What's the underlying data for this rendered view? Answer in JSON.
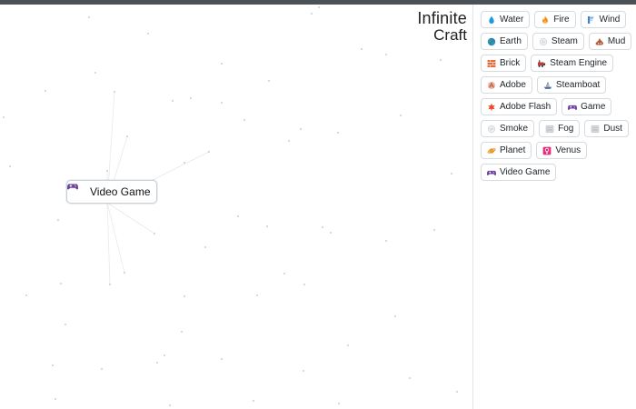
{
  "logo": {
    "line1": "Infinite",
    "line2": "Craft"
  },
  "canvas": {
    "items": [
      {
        "label": "Video Game",
        "icon": "gamepad-icon"
      }
    ]
  },
  "sidebar": {
    "items": [
      {
        "label": "Water",
        "icon": "water-drop-icon"
      },
      {
        "label": "Fire",
        "icon": "fire-icon"
      },
      {
        "label": "Wind",
        "icon": "wind-icon"
      },
      {
        "label": "Earth",
        "icon": "globe-icon"
      },
      {
        "label": "Steam",
        "icon": "steam-icon"
      },
      {
        "label": "Mud",
        "icon": "mud-icon"
      },
      {
        "label": "Brick",
        "icon": "brick-icon"
      },
      {
        "label": "Steam Engine",
        "icon": "steam-engine-icon"
      },
      {
        "label": "Adobe",
        "icon": "adobe-icon"
      },
      {
        "label": "Steamboat",
        "icon": "steamboat-icon"
      },
      {
        "label": "Adobe Flash",
        "icon": "flash-icon"
      },
      {
        "label": "Game",
        "icon": "gamepad-icon"
      },
      {
        "label": "Smoke",
        "icon": "smoke-icon"
      },
      {
        "label": "Fog",
        "icon": "fog-icon"
      },
      {
        "label": "Dust",
        "icon": "dust-icon"
      },
      {
        "label": "Planet",
        "icon": "planet-icon"
      },
      {
        "label": "Venus",
        "icon": "venus-icon"
      },
      {
        "label": "Video Game",
        "icon": "gamepad-icon"
      }
    ]
  },
  "colors": {
    "topbar": "#4a5258",
    "border": "#d6dbe0",
    "gamepad": "#6b3fa0"
  }
}
